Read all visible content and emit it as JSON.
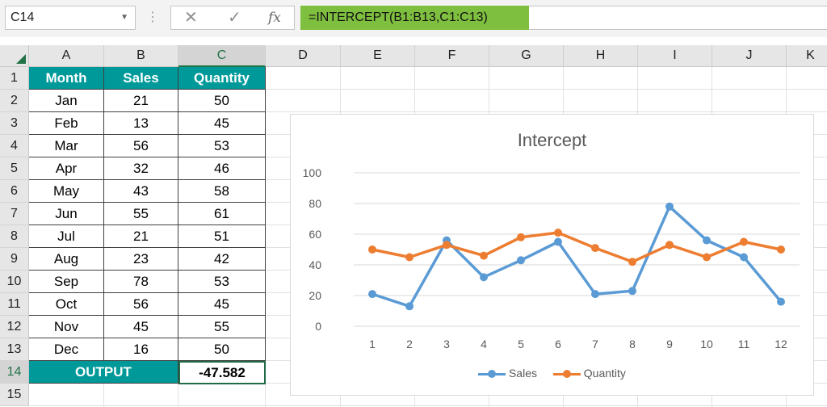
{
  "formula_bar": {
    "name_box": "C14",
    "cancel_icon": "✕",
    "enter_icon": "✓",
    "fx_label": "fx",
    "formula": "=INTERCEPT(B1:B13,C1:C13)"
  },
  "sheet": {
    "columns": [
      "A",
      "B",
      "C",
      "D",
      "E",
      "F",
      "G",
      "H",
      "I",
      "J",
      "K"
    ],
    "rows": [
      "1",
      "2",
      "3",
      "4",
      "5",
      "6",
      "7",
      "8",
      "9",
      "10",
      "11",
      "12",
      "13",
      "14",
      "15"
    ],
    "header": {
      "month": "Month",
      "sales": "Sales",
      "quantity": "Quantity"
    },
    "data": [
      {
        "month": "Jan",
        "sales": "21",
        "quantity": "50"
      },
      {
        "month": "Feb",
        "sales": "13",
        "quantity": "45"
      },
      {
        "month": "Mar",
        "sales": "56",
        "quantity": "53"
      },
      {
        "month": "Apr",
        "sales": "32",
        "quantity": "46"
      },
      {
        "month": "May",
        "sales": "43",
        "quantity": "58"
      },
      {
        "month": "Jun",
        "sales": "55",
        "quantity": "61"
      },
      {
        "month": "Jul",
        "sales": "21",
        "quantity": "51"
      },
      {
        "month": "Aug",
        "sales": "23",
        "quantity": "42"
      },
      {
        "month": "Sep",
        "sales": "78",
        "quantity": "53"
      },
      {
        "month": "Oct",
        "sales": "56",
        "quantity": "45"
      },
      {
        "month": "Nov",
        "sales": "45",
        "quantity": "55"
      },
      {
        "month": "Dec",
        "sales": "16",
        "quantity": "50"
      }
    ],
    "output_label": "OUTPUT",
    "output_value": "-47.582"
  },
  "colors": {
    "header_fill": "#009999",
    "formula_highlight": "#7fbf3f",
    "sales": "#5b9bd5",
    "quantity": "#ed7d31"
  },
  "chart_data": {
    "type": "line",
    "title": "Intercept",
    "x": [
      1,
      2,
      3,
      4,
      5,
      6,
      7,
      8,
      9,
      10,
      11,
      12
    ],
    "series": [
      {
        "name": "Sales",
        "values": [
          21,
          13,
          56,
          32,
          43,
          55,
          21,
          23,
          78,
          56,
          45,
          16
        ]
      },
      {
        "name": "Quantity",
        "values": [
          50,
          45,
          53,
          46,
          58,
          61,
          51,
          42,
          53,
          45,
          55,
          50
        ]
      }
    ],
    "ylim": [
      0,
      100
    ],
    "yticks": [
      0,
      20,
      40,
      60,
      80,
      100
    ],
    "grid": true,
    "legend": "bottom"
  }
}
